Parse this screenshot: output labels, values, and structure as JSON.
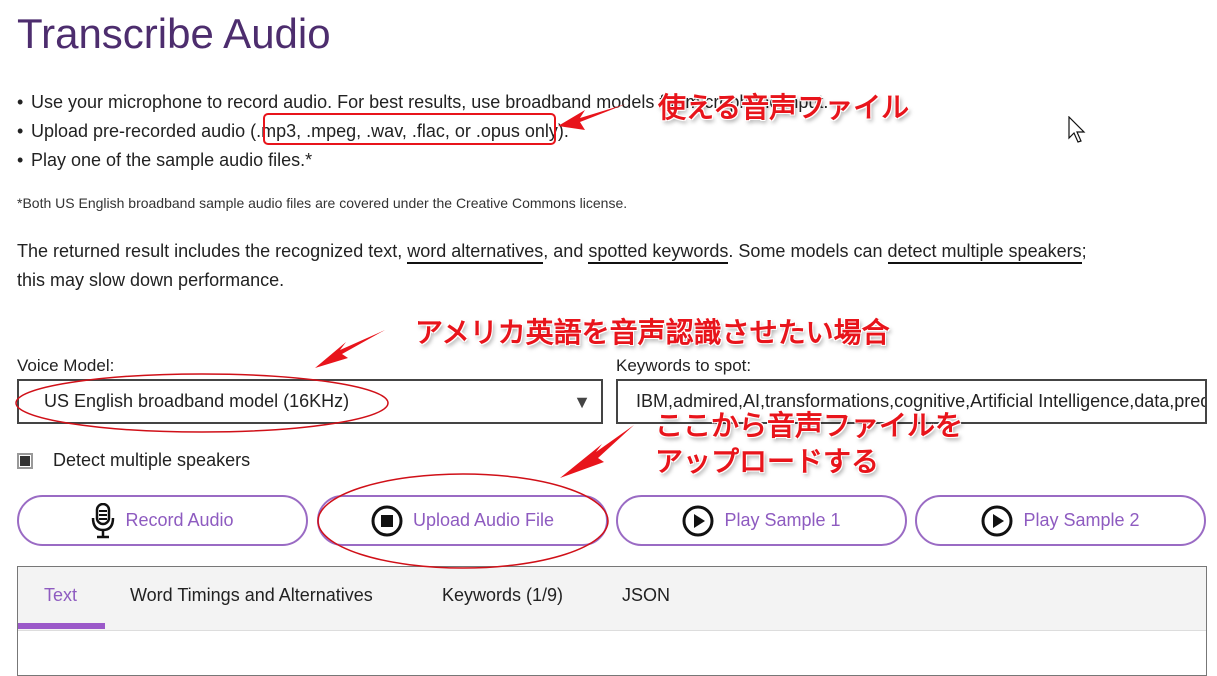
{
  "page": {
    "title": "Transcribe Audio",
    "bullets": [
      "Use your microphone to record audio. For best results, use broadband models for microphone input.",
      "Upload pre-recorded audio (.mp3, .mpeg, .wav, .flac, or .opus only).",
      "Play one of the sample audio files.*"
    ],
    "footnote": "*Both US English broadband sample audio files are covered under the Creative Commons license.",
    "description": {
      "part1": "The returned result includes the recognized text, ",
      "link1": "word alternatives",
      "part2": ", and ",
      "link2": "spotted keywords",
      "part3": ". Some models can ",
      "link3": "detect multiple speakers",
      "part4": "; this may slow down performance."
    }
  },
  "form": {
    "voice_model_label": "Voice Model:",
    "voice_model_value": "US English broadband model (16KHz)",
    "keywords_label": "Keywords to spot:",
    "keywords_value": "IBM,admired,AI,transformations,cognitive,Artificial Intelligence,data,predict,learn",
    "detect_speakers_label": "Detect multiple speakers",
    "detect_speakers_checked": true
  },
  "buttons": [
    {
      "label": "Record Audio",
      "icon": "microphone-icon"
    },
    {
      "label": "Upload Audio File",
      "icon": "stop-circle-icon"
    },
    {
      "label": "Play Sample 1",
      "icon": "play-circle-icon"
    },
    {
      "label": "Play Sample 2",
      "icon": "play-circle-icon"
    }
  ],
  "tabs": [
    {
      "label": "Text",
      "active": true
    },
    {
      "label": "Word Timings and Alternatives",
      "active": false
    },
    {
      "label": "Keywords (1/9)",
      "active": false
    },
    {
      "label": "JSON",
      "active": false
    }
  ],
  "annotations": {
    "formats_note": "使える音声ファイル",
    "model_note": "アメリカ英語を音声認識させたい場合",
    "upload_note_line1": "ここから音声ファイルを",
    "upload_note_line2": "アップロードする"
  },
  "colors": {
    "title": "#4d2d6e",
    "accent": "#8e5bc0",
    "annotation": "#e8141b"
  }
}
